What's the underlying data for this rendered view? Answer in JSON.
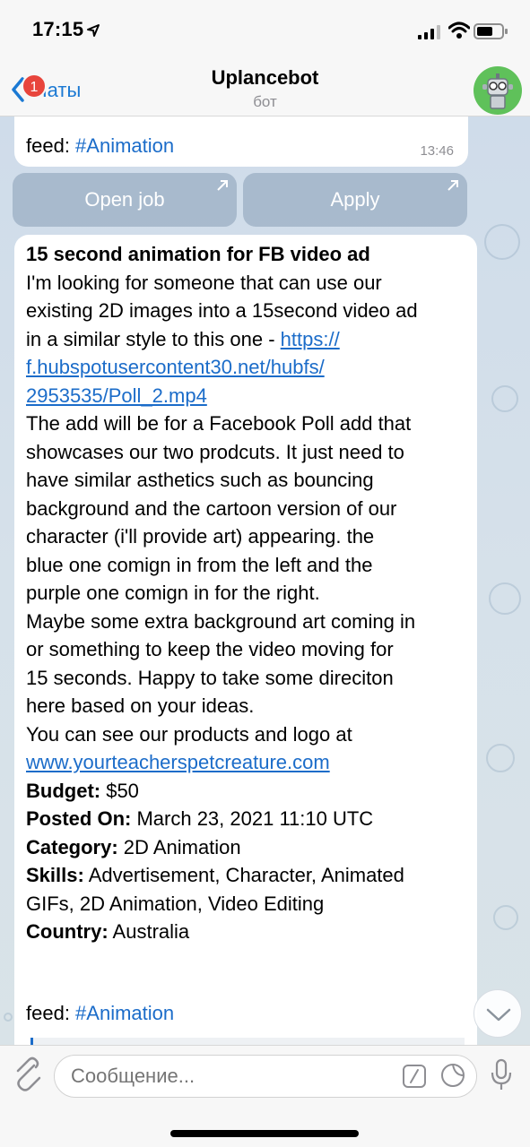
{
  "status_bar": {
    "time": "17:15"
  },
  "nav": {
    "back_label": "Чаты",
    "badge_count": "1",
    "title": "Uplancebot",
    "subtitle": "бот"
  },
  "message1": {
    "feed_prefix": "feed: ",
    "hashtag": "#Animation",
    "time": "13:46"
  },
  "keyboard": {
    "open_job": "Open job",
    "apply": "Apply"
  },
  "message2": {
    "title": "15 second animation for FB video ad",
    "lines": [
      "I'm looking for someone that can use our",
      "existing 2D images into a 15second video ad",
      "in a similar style to this one - "
    ],
    "link1_a": "https://",
    "link1_b": "f.hubspotusercontent30.net/hubfs/",
    "link1_c": "2953535/Poll_2.mp4",
    "lines2": [
      "The add will be for a Facebook Poll add that",
      "showcases our two prodcuts. It just need to",
      "have similar asthetics such as bouncing",
      "background and the cartoon version of our",
      "character (i'll provide art) appearing. the",
      "blue one comign in from the left and the",
      "purple one comign in for the right.",
      "Maybe some extra background art coming in",
      "or something to keep the video moving for",
      "15 seconds. Happy to take some direciton",
      "here based on your ideas.",
      "You can see our products and logo at"
    ],
    "link2": "www.yourteacherspetcreature.com",
    "budget_label": "Budget:",
    "budget_value": " $50",
    "posted_label": "Posted On:",
    "posted_value": " March 23, 2021 11:10 UTC",
    "category_label": "Category:",
    "category_value": " 2D Animation",
    "skills_label": "Skills:",
    "skills_value_1": " Advertisement, Character, Animated",
    "skills_value_2": "GIFs, 2D Animation, Video Editing",
    "country_label": "Country:",
    "country_value": " Australia",
    "feed_prefix": "feed: ",
    "hashtag": "#Animation"
  },
  "input": {
    "placeholder": "Сообщение..."
  },
  "colors": {
    "accent": "#1b79d3",
    "link": "#1b6cc9",
    "badge": "#e8453c",
    "avatar_bg": "#5fc15a"
  }
}
